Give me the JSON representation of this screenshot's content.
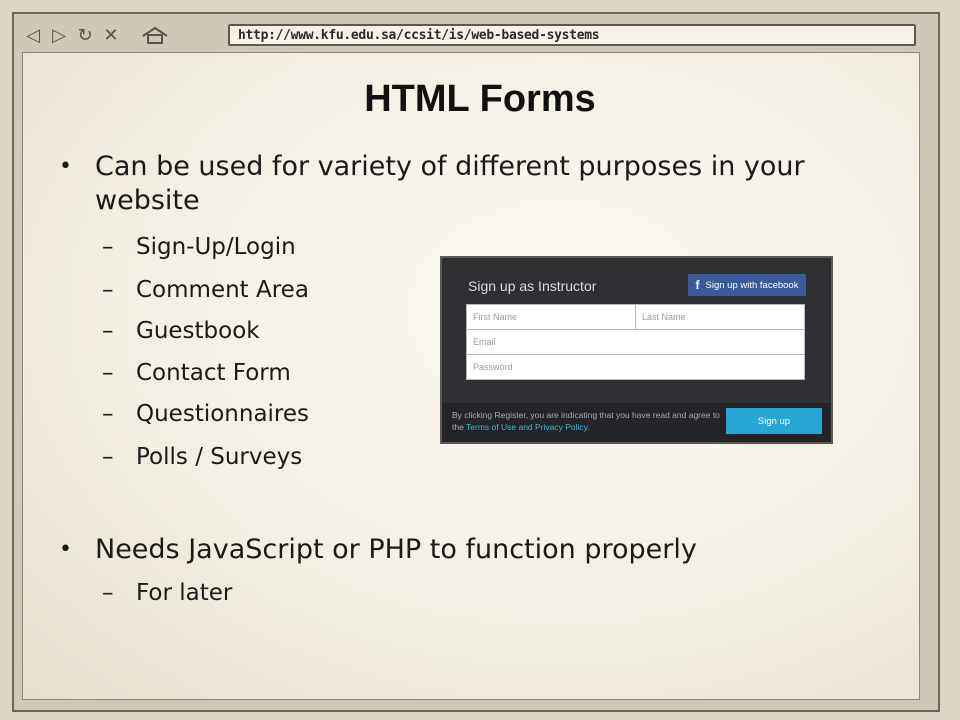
{
  "browser": {
    "url": "http://www.kfu.edu.sa/ccsit/is/web-based-systems",
    "back_icon": "back-arrow-icon",
    "forward_icon": "forward-arrow-icon",
    "refresh_icon": "refresh-icon",
    "stop_icon": "close-icon",
    "home_icon": "home-icon"
  },
  "slide": {
    "title": "HTML Forms",
    "bullets": [
      {
        "text": "Can be used for variety of different purposes in your website",
        "subitems": [
          "Sign-Up/Login",
          "Comment Area",
          "Guestbook",
          "Contact Form",
          "Questionnaires",
          "Polls / Surveys"
        ]
      },
      {
        "text": "Needs JavaScript or PHP to function properly",
        "subitems": [
          "For later"
        ]
      }
    ]
  },
  "form_image": {
    "title": "Sign up as Instructor",
    "facebook_button": "Sign up with facebook",
    "first_name_placeholder": "First Name",
    "last_name_placeholder": "Last Name",
    "email_placeholder": "Email",
    "password_placeholder": "Password",
    "footer_text": "By clicking Register, you are indicating that you have read and agree to the",
    "footer_link": "Terms of Use and Privacy Policy.",
    "signup_button": "Sign up",
    "colors": {
      "panel_bg": "#2e3033",
      "facebook": "#3b5998",
      "signup": "#27a6d3",
      "link": "#4fb5d9"
    }
  }
}
